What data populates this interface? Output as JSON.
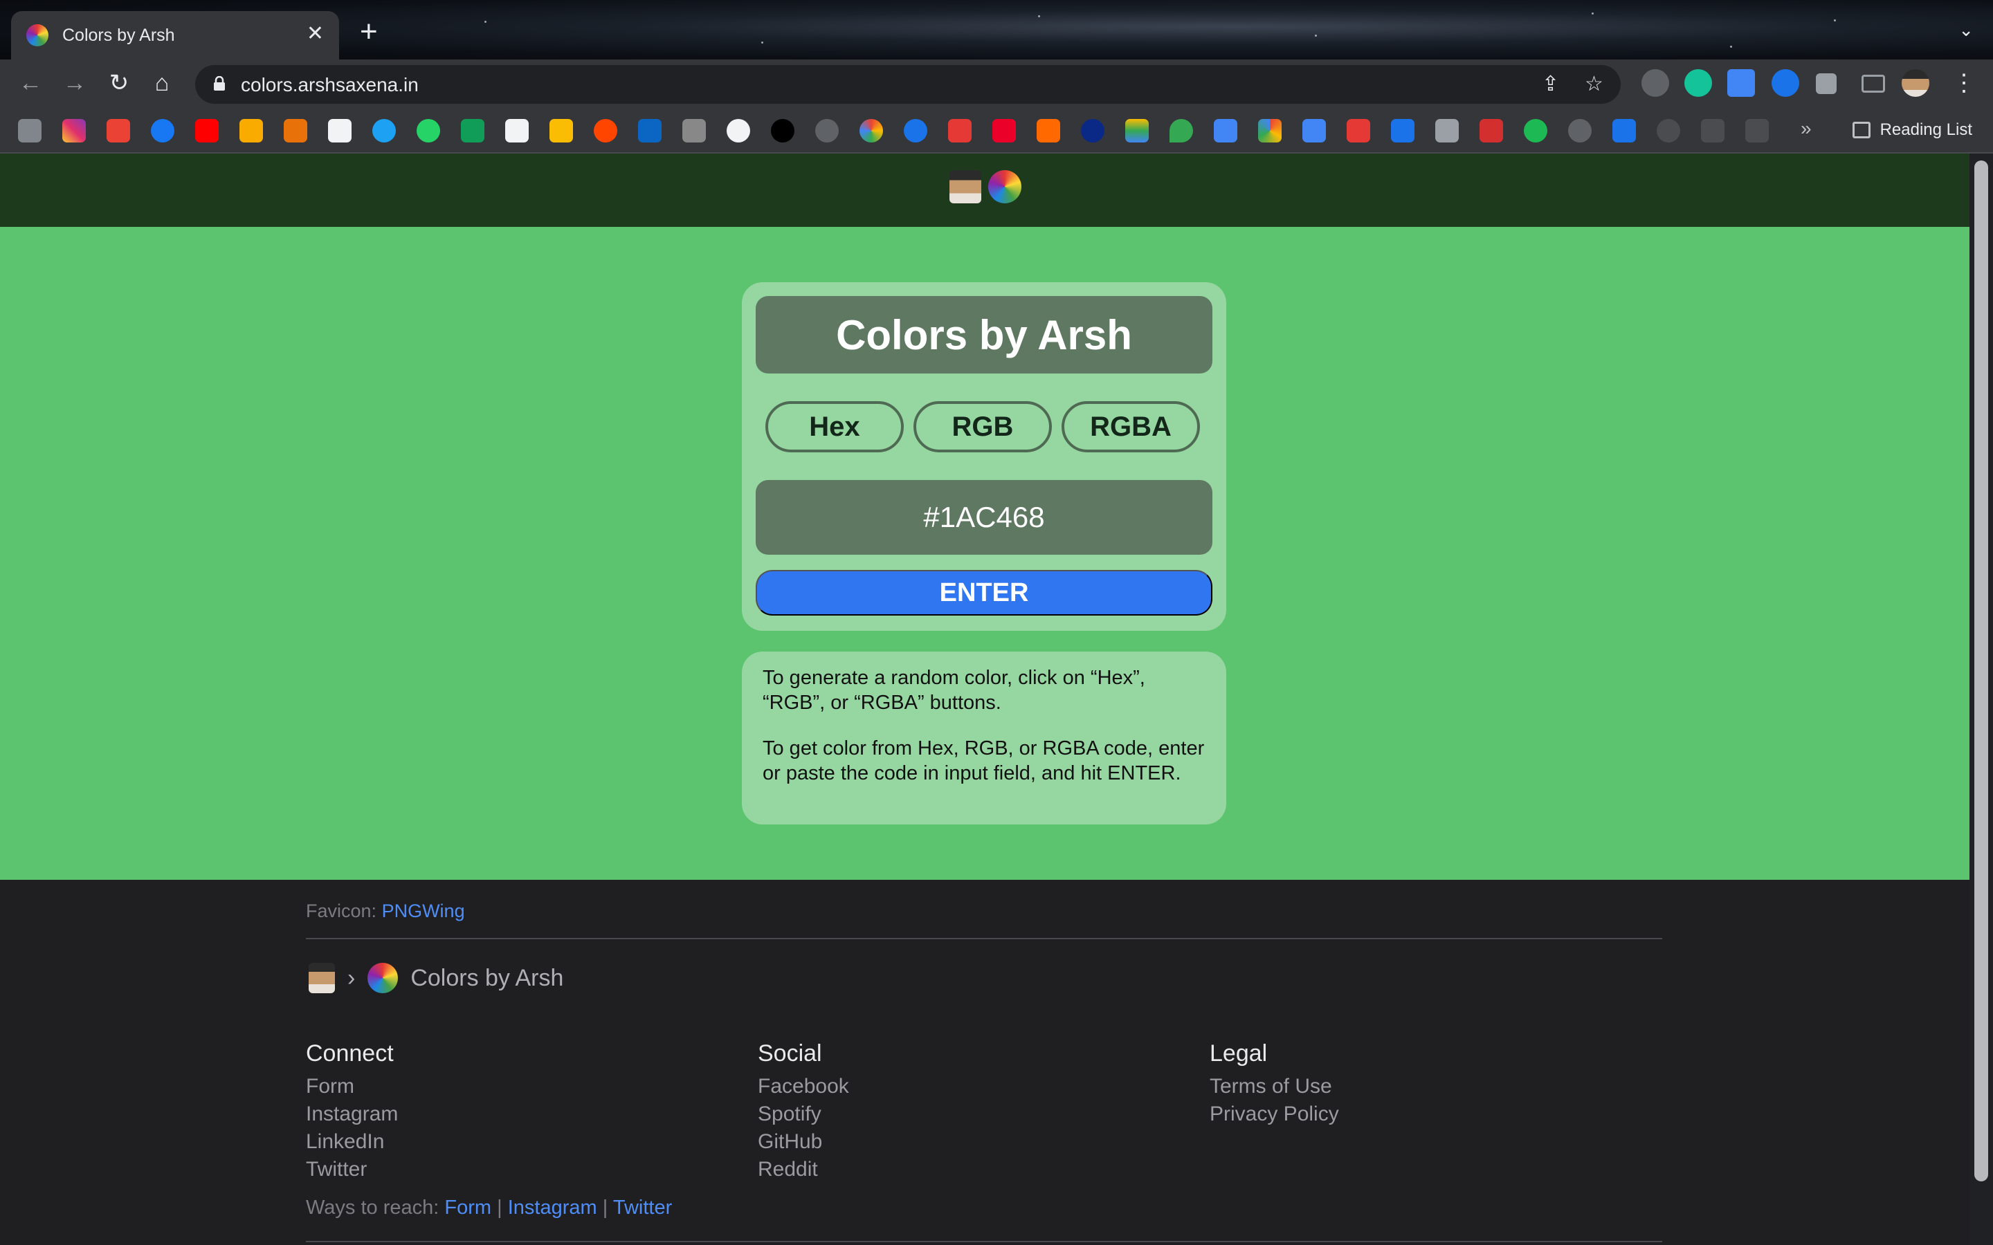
{
  "browser": {
    "tab_title": "Colors by Arsh",
    "url": "colors.arshsaxena.in",
    "reading_list": "Reading List",
    "overflow": "»"
  },
  "header": {},
  "app": {
    "title": "Colors by Arsh",
    "buttons": [
      "Hex",
      "RGB",
      "RGBA"
    ],
    "color_code": "#1AC468",
    "enter_label": "ENTER",
    "bg_color": "#5cc36f"
  },
  "info": {
    "p1": "To generate a random color, click on “Hex”, “RGB”, or “RGBA” buttons.",
    "p2": "To get color from Hex, RGB, or RGBA code, enter or paste the code in input field, and hit ENTER."
  },
  "footer": {
    "favicon_label": "Favicon:",
    "favicon_link": "PNGWing",
    "breadcrumb_sep": "›",
    "breadcrumb_title": "Colors by Arsh",
    "connect": {
      "heading": "Connect",
      "links": [
        "Form",
        "Instagram",
        "LinkedIn",
        "Twitter"
      ]
    },
    "social": {
      "heading": "Social",
      "links": [
        "Facebook",
        "Spotify",
        "GitHub",
        "Reddit"
      ]
    },
    "legal": {
      "heading": "Legal",
      "links": [
        "Terms of Use",
        "Privacy Policy"
      ]
    },
    "ways_label": "Ways to reach:",
    "ways_links": [
      "Form",
      "Instagram",
      "Twitter"
    ],
    "ways_sep": "|"
  }
}
